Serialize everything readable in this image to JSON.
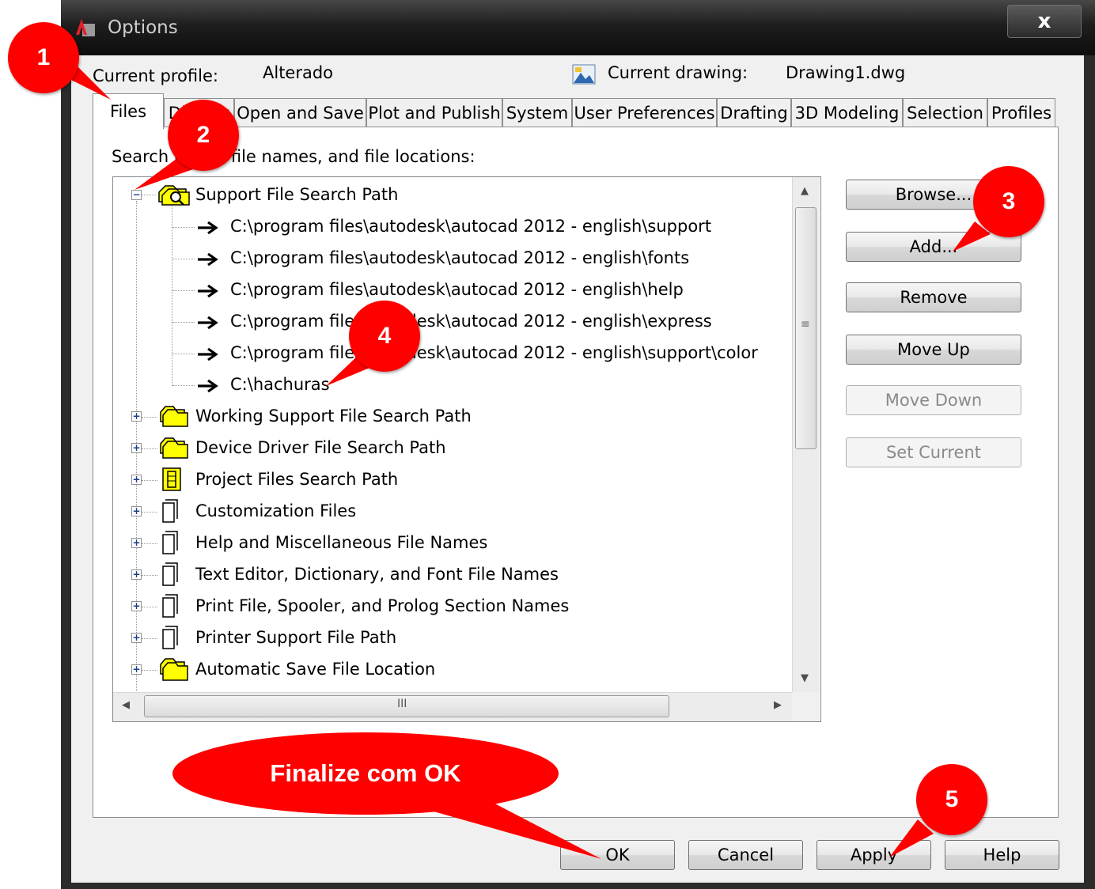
{
  "window": {
    "title": "Options",
    "close_label": "x"
  },
  "header": {
    "profile_label": "Current profile:",
    "profile_value": "Alterado",
    "drawing_label": "Current drawing:",
    "drawing_value": "Drawing1.dwg"
  },
  "tabs": [
    {
      "label": "Files",
      "active": true
    },
    {
      "label": "Display",
      "active": false
    },
    {
      "label": "Open and Save",
      "active": false
    },
    {
      "label": "Plot and Publish",
      "active": false
    },
    {
      "label": "System",
      "active": false
    },
    {
      "label": "User Preferences",
      "active": false
    },
    {
      "label": "Drafting",
      "active": false
    },
    {
      "label": "3D Modeling",
      "active": false
    },
    {
      "label": "Selection",
      "active": false
    },
    {
      "label": "Profiles",
      "active": false
    }
  ],
  "files_panel": {
    "heading": "Search paths, file names, and file locations:",
    "tree": {
      "expanded_node": {
        "label": "Support File Search Path",
        "icon": "folders-search-icon",
        "children": [
          "C:\\program files\\autodesk\\autocad 2012 - english\\support",
          "C:\\program files\\autodesk\\autocad 2012 - english\\fonts",
          "C:\\program files\\autodesk\\autocad 2012 - english\\help",
          "C:\\program files\\autodesk\\autocad 2012 - english\\express",
          "C:\\program files\\autodesk\\autocad 2012 - english\\support\\color",
          "C:\\hachuras"
        ]
      },
      "collapsed_nodes": [
        {
          "label": "Working Support File Search Path",
          "icon": "folders-icon"
        },
        {
          "label": "Device Driver File Search Path",
          "icon": "folders-icon"
        },
        {
          "label": "Project Files Search Path",
          "icon": "project-icon"
        },
        {
          "label": "Customization Files",
          "icon": "file-icon"
        },
        {
          "label": "Help and Miscellaneous File Names",
          "icon": "file-icon"
        },
        {
          "label": "Text Editor, Dictionary, and Font File Names",
          "icon": "file-icon"
        },
        {
          "label": "Print File, Spooler, and Prolog Section Names",
          "icon": "file-icon"
        },
        {
          "label": "Printer Support File Path",
          "icon": "file-icon"
        },
        {
          "label": "Automatic Save File Location",
          "icon": "folders-icon"
        }
      ]
    },
    "hscroll_thumb_label": "III"
  },
  "side_buttons": {
    "browse": "Browse...",
    "add": "Add...",
    "remove": "Remove",
    "move_up": "Move Up",
    "move_down": "Move Down",
    "set_current": "Set Current"
  },
  "footer_buttons": {
    "ok": "OK",
    "cancel": "Cancel",
    "apply": "Apply",
    "help": "Help"
  },
  "callouts": {
    "c1": "1",
    "c2": "2",
    "c3": "3",
    "c4": "4",
    "c5": "5",
    "finalize": "Finalize com OK"
  },
  "colors": {
    "callout": "#ff0000",
    "folder": "#ffff00",
    "titlebar": "#1e1e1e"
  }
}
